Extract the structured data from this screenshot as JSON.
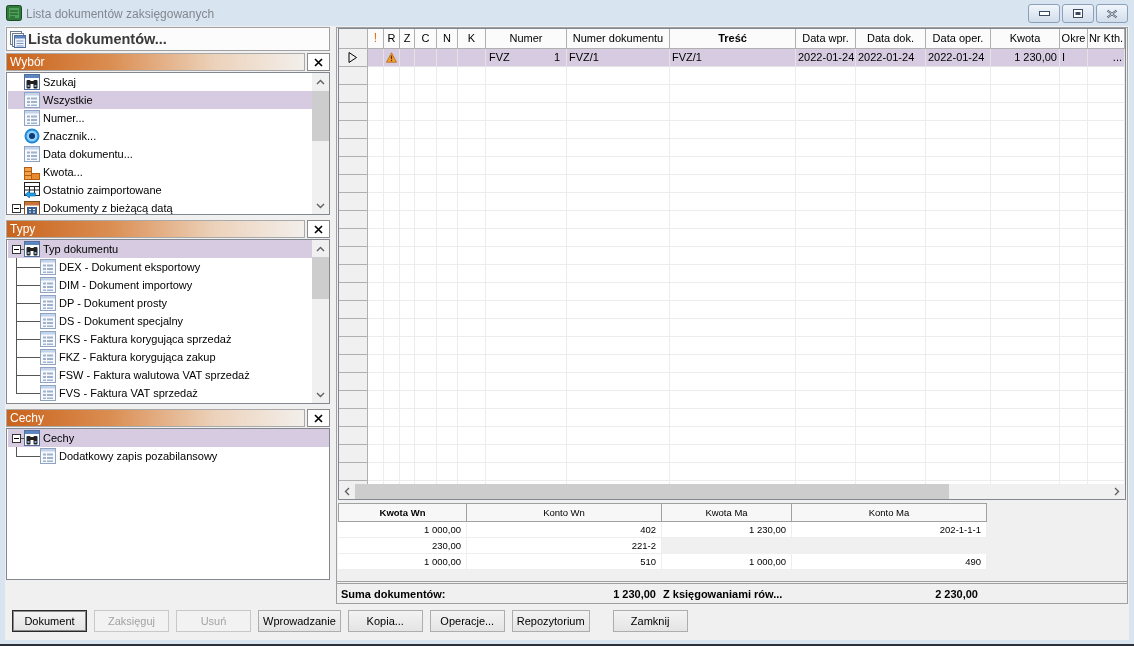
{
  "window": {
    "title": "Lista dokumentów zaksięgowanych"
  },
  "selection_panel": {
    "title": "Lista dokumentów...",
    "sections": [
      {
        "title": "Wybór",
        "items": [
          {
            "label": "Szukaj",
            "kind": "search",
            "selected": false
          },
          {
            "label": "Wszystkie",
            "kind": "list",
            "selected": true
          },
          {
            "label": "Numer...",
            "kind": "list",
            "selected": false
          },
          {
            "label": "Znacznik...",
            "kind": "tag",
            "selected": false
          },
          {
            "label": "Data dokumentu...",
            "kind": "list",
            "selected": false
          },
          {
            "label": "Kwota...",
            "kind": "amount",
            "selected": false
          },
          {
            "label": "Ostatnio zaimportowane",
            "kind": "import",
            "selected": false
          },
          {
            "label": "Dokumenty z bieżącą datą",
            "kind": "date",
            "selected": false,
            "expanded": true
          }
        ]
      },
      {
        "title": "Typy",
        "items": [
          {
            "label": "Typ dokumentu",
            "kind": "search",
            "selected": true,
            "expanded": true,
            "children": [
              {
                "label": "DEX - Dokument eksportowy",
                "kind": "list",
                "selected": false
              },
              {
                "label": "DIM - Dokument importowy",
                "kind": "list",
                "selected": false
              },
              {
                "label": "DP - Dokument prosty",
                "kind": "list",
                "selected": false
              },
              {
                "label": "DS - Dokument specjalny",
                "kind": "list",
                "selected": false
              },
              {
                "label": "FKS - Faktura korygująca sprzedaż",
                "kind": "list",
                "selected": false
              },
              {
                "label": "FKZ - Faktura korygująca zakup",
                "kind": "list",
                "selected": false
              },
              {
                "label": "FSW - Faktura walutowa VAT sprzedaż",
                "kind": "list",
                "selected": false
              },
              {
                "label": "FVS - Faktura VAT sprzedaż",
                "kind": "list",
                "selected": false
              }
            ]
          }
        ]
      },
      {
        "title": "Cechy",
        "items": [
          {
            "label": "Cechy",
            "kind": "search",
            "selected": true,
            "expanded": true,
            "children": [
              {
                "label": "Dodatkowy zapis pozabilansowy",
                "kind": "list",
                "selected": false
              }
            ]
          }
        ]
      }
    ]
  },
  "documents_table": {
    "columns": [
      {
        "label": "!",
        "kind": "flag",
        "sorted": false
      },
      {
        "label": "R",
        "kind": "text",
        "sorted": false
      },
      {
        "label": "Z",
        "kind": "text",
        "sorted": false
      },
      {
        "label": "C",
        "kind": "text",
        "sorted": false
      },
      {
        "label": "N",
        "kind": "text",
        "sorted": false
      },
      {
        "label": "K",
        "kind": "text",
        "sorted": false
      },
      {
        "label": "Numer",
        "kind": "text",
        "sorted": false
      },
      {
        "label": "Numer dokumentu",
        "kind": "text",
        "sorted": false
      },
      {
        "label": "Treść",
        "kind": "text",
        "sorted": true
      },
      {
        "label": "Data wpr.",
        "kind": "text",
        "sorted": false
      },
      {
        "label": "Data dok.",
        "kind": "text",
        "sorted": false
      },
      {
        "label": "Data oper.",
        "kind": "text",
        "sorted": false
      },
      {
        "label": "Kwota",
        "kind": "number",
        "sorted": false
      },
      {
        "label": "Okre",
        "kind": "text",
        "sorted": false
      },
      {
        "label": "Nr Kth.",
        "kind": "number",
        "sorted": false
      }
    ],
    "rows": [
      {
        "selected": true,
        "current": true,
        "warning": true,
        "numer": {
          "series": "FVZ",
          "number": "1"
        },
        "numer_dokumentu": "FVZ/1",
        "tresc": "FVZ/1",
        "data_wpr": "2022-01-24",
        "data_dok": "2022-01-24",
        "data_oper": "2022-01-24",
        "kwota": "1 230,00",
        "okres": "I",
        "nr_kth": "..."
      }
    ]
  },
  "postings_table": {
    "columns": [
      {
        "label": "Kwota Wn",
        "sorted": true
      },
      {
        "label": "Konto Wn",
        "sorted": false
      },
      {
        "label": "Kwota Ma",
        "sorted": false
      },
      {
        "label": "Konto Ma",
        "sorted": false
      }
    ],
    "rows": [
      {
        "kwota_wn": "1 000,00",
        "konto_wn": "402",
        "kwota_ma": "1 230,00",
        "konto_ma": "202-1-1-1"
      },
      {
        "kwota_wn": "230,00",
        "konto_wn": "221-2"
      },
      {
        "kwota_wn": "1 000,00",
        "konto_wn": "510",
        "kwota_ma": "1 000,00",
        "konto_ma": "490"
      }
    ]
  },
  "totals": [
    {
      "label": "Suma dokumentów:",
      "value": "1 230,00"
    },
    {
      "label": "Z księgowaniami rów...",
      "value": "2 230,00"
    }
  ],
  "buttons": [
    {
      "label": "Dokument",
      "disabled": false,
      "default": true
    },
    {
      "label": "Zaksięguj",
      "disabled": true,
      "default": false
    },
    {
      "label": "Usuń",
      "disabled": true,
      "default": false
    },
    {
      "label": "Wprowadzanie",
      "disabled": false,
      "default": false
    },
    {
      "label": "Kopia...",
      "disabled": false,
      "default": false
    },
    {
      "label": "Operacje...",
      "disabled": false,
      "default": false
    },
    {
      "label": "Repozytorium",
      "disabled": false,
      "default": false
    },
    {
      "label": "Zamknij",
      "disabled": false,
      "default": false
    }
  ]
}
